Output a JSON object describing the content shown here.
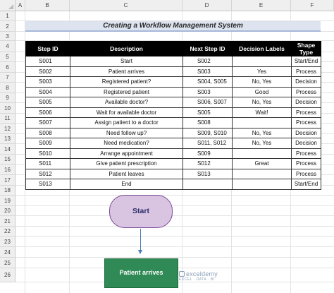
{
  "sheet": {
    "columns": [
      "A",
      "B",
      "C",
      "D",
      "E",
      "F"
    ],
    "rows": [
      "1",
      "2",
      "3",
      "4",
      "5",
      "6",
      "7",
      "8",
      "9",
      "10",
      "11",
      "12",
      "13",
      "14",
      "15",
      "16",
      "17",
      "18",
      "19",
      "20",
      "21",
      "22",
      "23",
      "24",
      "25",
      "26"
    ]
  },
  "title": "Creating a Workflow Management System",
  "table": {
    "headers": [
      "Step ID",
      "Description",
      "Next Step ID",
      "Decision Labels",
      "Shape Type"
    ],
    "rows": [
      {
        "id": "S001",
        "desc": "Start",
        "next": "S002",
        "dec": "",
        "shape": "Start/End"
      },
      {
        "id": "S002",
        "desc": "Patient arrives",
        "next": "S003",
        "dec": "Yes",
        "shape": "Process"
      },
      {
        "id": "S003",
        "desc": "Registered patient?",
        "next": "S004, S005",
        "dec": "No, Yes",
        "shape": "Decision"
      },
      {
        "id": "S004",
        "desc": "Registered patient",
        "next": "S003",
        "dec": "Good",
        "shape": "Process"
      },
      {
        "id": "S005",
        "desc": "Available doctor?",
        "next": "S006, S007",
        "dec": "No, Yes",
        "shape": "Decision"
      },
      {
        "id": "S006",
        "desc": "Wait for available doctor",
        "next": "S005",
        "dec": "Wait!",
        "shape": "Process"
      },
      {
        "id": "S007",
        "desc": "Assign patient to a doctor",
        "next": "S008",
        "dec": "",
        "shape": "Process"
      },
      {
        "id": "S008",
        "desc": "Need follow up?",
        "next": "S009, S010",
        "dec": "No, Yes",
        "shape": "Decision"
      },
      {
        "id": "S009",
        "desc": "Need medication?",
        "next": "S011, S012",
        "dec": "No, Yes",
        "shape": "Decision"
      },
      {
        "id": "S010",
        "desc": "Arrange appointment",
        "next": "S009",
        "dec": "",
        "shape": "Process"
      },
      {
        "id": "S011",
        "desc": "Give patient prescription",
        "next": "S012",
        "dec": "Great",
        "shape": "Process"
      },
      {
        "id": "S012",
        "desc": "Patient leaves",
        "next": "S013",
        "dec": "",
        "shape": "Process"
      },
      {
        "id": "S013",
        "desc": "End",
        "next": "",
        "dec": "",
        "shape": "Start/End"
      }
    ]
  },
  "flowchart": {
    "start_label": "Start",
    "process_label": "Patient arrives"
  },
  "watermark": {
    "name": "exceldemy",
    "tagline": "EXCEL · DATA · BI"
  },
  "colors": {
    "title_bg": "#dde3ef",
    "header_bg": "#000000",
    "start_fill": "#d9c5e2",
    "process_fill": "#2f8a55",
    "arrow": "#4a78b8"
  }
}
